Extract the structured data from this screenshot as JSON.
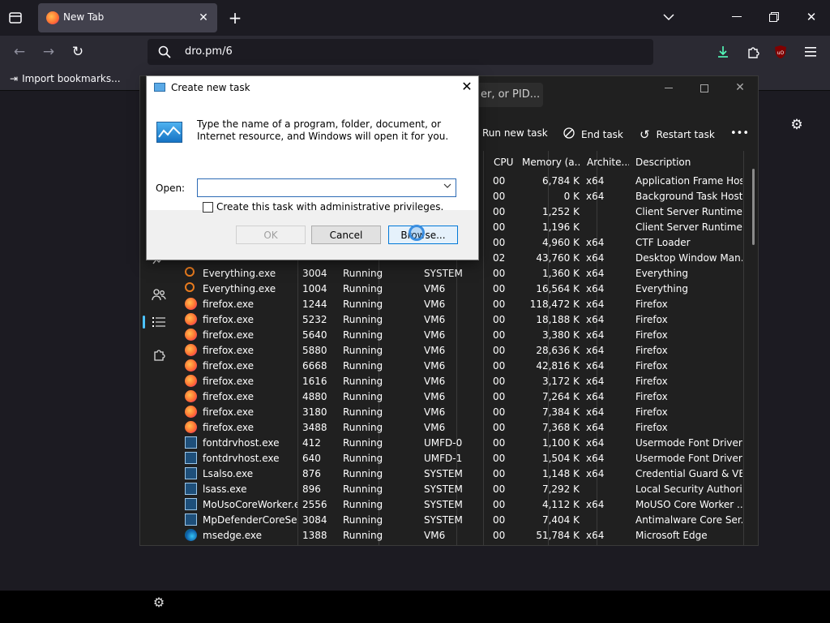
{
  "browser": {
    "tab_title": "New Tab",
    "url": "dro.pm/6",
    "bookmark_item": "Import bookmarks...",
    "colors": {
      "chrome_dark": "#1c1b22",
      "toolbar": "#2b2a33",
      "tab_active": "#42414d",
      "download_accent": "#54ffbd"
    }
  },
  "task_manager": {
    "search_placeholder": "er, or PID...",
    "toolbar": {
      "run_new_task": "Run new task",
      "end_task": "End task",
      "restart_task": "Restart task",
      "more": "•••"
    },
    "columns": [
      "CPU",
      "Memory (a...",
      "Archite...",
      "Description"
    ],
    "rows": [
      {
        "name": "",
        "pid": "",
        "status": "",
        "user": "",
        "cpu": "00",
        "mem": "6,784 K",
        "arch": "x64",
        "desc": "Application Frame Host",
        "icon": "none"
      },
      {
        "name": "",
        "pid": "",
        "status": "",
        "user": "",
        "cpu": "00",
        "mem": "0 K",
        "arch": "x64",
        "desc": "Background Task Host",
        "icon": "none"
      },
      {
        "name": "",
        "pid": "",
        "status": "",
        "user": "",
        "cpu": "00",
        "mem": "1,252 K",
        "arch": "",
        "desc": "Client Server Runtime ...",
        "icon": "none"
      },
      {
        "name": "",
        "pid": "",
        "status": "",
        "user": "",
        "cpu": "00",
        "mem": "1,196 K",
        "arch": "",
        "desc": "Client Server Runtime ...",
        "icon": "none"
      },
      {
        "name": "",
        "pid": "",
        "status": "",
        "user": "",
        "cpu": "00",
        "mem": "4,960 K",
        "arch": "x64",
        "desc": "CTF Loader",
        "icon": "none"
      },
      {
        "name": "",
        "pid": "",
        "status": "",
        "user": "",
        "cpu": "02",
        "mem": "43,760 K",
        "arch": "x64",
        "desc": "Desktop Window Man...",
        "icon": "none"
      },
      {
        "name": "Everything.exe",
        "pid": "3004",
        "status": "Running",
        "user": "SYSTEM",
        "cpu": "00",
        "mem": "1,360 K",
        "arch": "x64",
        "desc": "Everything",
        "icon": "search"
      },
      {
        "name": "Everything.exe",
        "pid": "1004",
        "status": "Running",
        "user": "VM6",
        "cpu": "00",
        "mem": "16,564 K",
        "arch": "x64",
        "desc": "Everything",
        "icon": "search"
      },
      {
        "name": "firefox.exe",
        "pid": "1244",
        "status": "Running",
        "user": "VM6",
        "cpu": "00",
        "mem": "118,472 K",
        "arch": "x64",
        "desc": "Firefox",
        "icon": "fx"
      },
      {
        "name": "firefox.exe",
        "pid": "5232",
        "status": "Running",
        "user": "VM6",
        "cpu": "00",
        "mem": "18,188 K",
        "arch": "x64",
        "desc": "Firefox",
        "icon": "fx"
      },
      {
        "name": "firefox.exe",
        "pid": "5640",
        "status": "Running",
        "user": "VM6",
        "cpu": "00",
        "mem": "3,380 K",
        "arch": "x64",
        "desc": "Firefox",
        "icon": "fx"
      },
      {
        "name": "firefox.exe",
        "pid": "5880",
        "status": "Running",
        "user": "VM6",
        "cpu": "00",
        "mem": "28,636 K",
        "arch": "x64",
        "desc": "Firefox",
        "icon": "fx"
      },
      {
        "name": "firefox.exe",
        "pid": "6668",
        "status": "Running",
        "user": "VM6",
        "cpu": "00",
        "mem": "42,816 K",
        "arch": "x64",
        "desc": "Firefox",
        "icon": "fx"
      },
      {
        "name": "firefox.exe",
        "pid": "1616",
        "status": "Running",
        "user": "VM6",
        "cpu": "00",
        "mem": "3,172 K",
        "arch": "x64",
        "desc": "Firefox",
        "icon": "fx"
      },
      {
        "name": "firefox.exe",
        "pid": "4880",
        "status": "Running",
        "user": "VM6",
        "cpu": "00",
        "mem": "7,264 K",
        "arch": "x64",
        "desc": "Firefox",
        "icon": "fx"
      },
      {
        "name": "firefox.exe",
        "pid": "3180",
        "status": "Running",
        "user": "VM6",
        "cpu": "00",
        "mem": "7,384 K",
        "arch": "x64",
        "desc": "Firefox",
        "icon": "fx"
      },
      {
        "name": "firefox.exe",
        "pid": "3488",
        "status": "Running",
        "user": "VM6",
        "cpu": "00",
        "mem": "7,368 K",
        "arch": "x64",
        "desc": "Firefox",
        "icon": "fx"
      },
      {
        "name": "fontdrvhost.exe",
        "pid": "412",
        "status": "Running",
        "user": "UMFD-0",
        "cpu": "00",
        "mem": "1,100 K",
        "arch": "x64",
        "desc": "Usermode Font Driver ...",
        "icon": "gen"
      },
      {
        "name": "fontdrvhost.exe",
        "pid": "640",
        "status": "Running",
        "user": "UMFD-1",
        "cpu": "00",
        "mem": "1,504 K",
        "arch": "x64",
        "desc": "Usermode Font Driver ...",
        "icon": "gen"
      },
      {
        "name": "Lsalso.exe",
        "pid": "876",
        "status": "Running",
        "user": "SYSTEM",
        "cpu": "00",
        "mem": "1,148 K",
        "arch": "x64",
        "desc": "Credential Guard & VB...",
        "icon": "gen"
      },
      {
        "name": "lsass.exe",
        "pid": "896",
        "status": "Running",
        "user": "SYSTEM",
        "cpu": "00",
        "mem": "7,292 K",
        "arch": "",
        "desc": "Local Security Authori...",
        "icon": "gen"
      },
      {
        "name": "MoUsoCoreWorker.e...",
        "pid": "2556",
        "status": "Running",
        "user": "SYSTEM",
        "cpu": "00",
        "mem": "4,112 K",
        "arch": "x64",
        "desc": "MoUSO Core Worker ...",
        "icon": "gen"
      },
      {
        "name": "MpDefenderCoreSer...",
        "pid": "3084",
        "status": "Running",
        "user": "SYSTEM",
        "cpu": "00",
        "mem": "7,404 K",
        "arch": "",
        "desc": "Antimalware Core Ser...",
        "icon": "gen"
      },
      {
        "name": "msedge.exe",
        "pid": "1388",
        "status": "Running",
        "user": "VM6",
        "cpu": "00",
        "mem": "51,784 K",
        "arch": "x64",
        "desc": "Microsoft Edge",
        "icon": "edge"
      }
    ]
  },
  "dialog": {
    "title": "Create new task",
    "description": "Type the name of a program, folder, document, or Internet resource, and Windows will open it for you.",
    "open_label": "Open:",
    "open_value": "",
    "checkbox_label": "Create this task with administrative privileges.",
    "ok_label": "OK",
    "cancel_label": "Cancel",
    "browse_label": "Browse..."
  }
}
